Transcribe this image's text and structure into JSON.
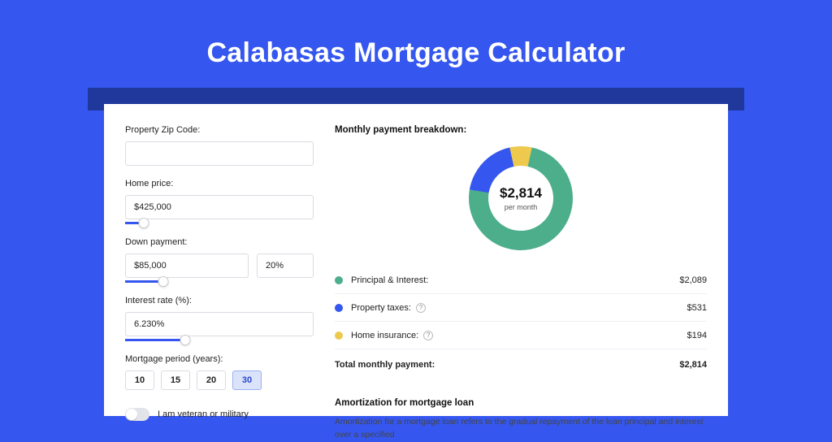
{
  "title": "Calabasas Mortgage Calculator",
  "form": {
    "zip_label": "Property Zip Code:",
    "zip_value": "",
    "home_price_label": "Home price:",
    "home_price_value": "$425,000",
    "down_payment_label": "Down payment:",
    "down_payment_value": "$85,000",
    "down_payment_pct": "20%",
    "interest_label": "Interest rate (%):",
    "interest_value": "6.230%",
    "period_label": "Mortgage period (years):",
    "period_options": [
      "10",
      "15",
      "20",
      "30"
    ],
    "period_selected": "30",
    "veteran_label": "I am veteran or military",
    "sliders": {
      "home_price_pct": 10,
      "down_payment_pct": 30,
      "interest_pct": 32
    }
  },
  "breakdown": {
    "title": "Monthly payment breakdown:",
    "total_value": "$2,814",
    "total_sub": "per month",
    "rows": [
      {
        "label": "Principal & Interest:",
        "value": "$2,089",
        "color": "#4cae8b",
        "info": false
      },
      {
        "label": "Property taxes:",
        "value": "$531",
        "color": "#3557ef",
        "info": true
      },
      {
        "label": "Home insurance:",
        "value": "$194",
        "color": "#edc94d",
        "info": true
      }
    ],
    "total_row": {
      "label": "Total monthly payment:",
      "value": "$2,814"
    }
  },
  "amort": {
    "title": "Amortization for mortgage loan",
    "text": "Amortization for a mortgage loan refers to the gradual repayment of the loan principal and interest over a specified"
  },
  "chart_data": {
    "type": "pie",
    "title": "Monthly payment breakdown",
    "series": [
      {
        "name": "Principal & Interest",
        "value": 2089,
        "color": "#4cae8b"
      },
      {
        "name": "Property taxes",
        "value": 531,
        "color": "#3557ef"
      },
      {
        "name": "Home insurance",
        "value": 194,
        "color": "#edc94d"
      }
    ],
    "total": 2814
  }
}
